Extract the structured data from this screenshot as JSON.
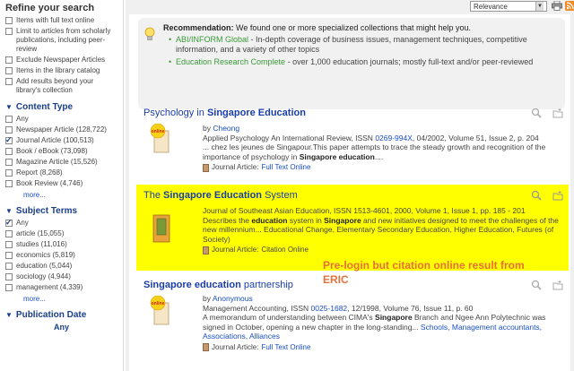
{
  "sidebar": {
    "title": "Refine your search",
    "refine_options": [
      {
        "label": "Items with full text online",
        "checked": false
      },
      {
        "label": "Limit to articles from scholarly publications, including peer-review",
        "checked": false
      },
      {
        "label": "Exclude Newspaper Articles",
        "checked": false
      },
      {
        "label": "Items in the library catalog",
        "checked": false
      },
      {
        "label": "Add results beyond your library's collection",
        "checked": false
      }
    ],
    "content_type": {
      "title": "Content Type",
      "items": [
        {
          "label": "Any",
          "checked": false
        },
        {
          "label": "Newspaper Article (128,722)",
          "checked": false
        },
        {
          "label": "Journal Article (100,513)",
          "checked": true
        },
        {
          "label": "Book / eBook (73,098)",
          "checked": false
        },
        {
          "label": "Magazine Article (15,526)",
          "checked": false
        },
        {
          "label": "Report (8,268)",
          "checked": false
        },
        {
          "label": "Book Review (4,746)",
          "checked": false
        }
      ],
      "more": "more..."
    },
    "subject_terms": {
      "title": "Subject Terms",
      "items": [
        {
          "label": "Any",
          "checked": true
        },
        {
          "label": "article (15,055)",
          "checked": false
        },
        {
          "label": "studies (11,016)",
          "checked": false
        },
        {
          "label": "economics (5,819)",
          "checked": false
        },
        {
          "label": "education (5,044)",
          "checked": false
        },
        {
          "label": "sociology (4,944)",
          "checked": false
        },
        {
          "label": "management (4,339)",
          "checked": false
        }
      ],
      "more": "more..."
    },
    "publication_date": {
      "title": "Publication Date",
      "value": "Any"
    }
  },
  "toolbar": {
    "sort_value": "Relevance",
    "print_icon": "print-icon",
    "rss_icon": "rss-icon"
  },
  "recommendation": {
    "label": "Recommendation:",
    "text": " We found one or more specialized collections that might help you.",
    "items": [
      {
        "link": "ABI/INFORM Global",
        "desc": " - In-depth coverage of business issues, management techniques, competitive information, and a variety of other topics"
      },
      {
        "link": "Education Research Complete",
        "desc": " - over 1,000 education journals; mostly full-text and/or peer-reviewed"
      }
    ]
  },
  "results": [
    {
      "title_pre": "Psychology in ",
      "title_bold": "Singapore Education",
      "title_post": "",
      "by": "by ",
      "author": "Cheong",
      "source_pre": "Applied Psychology An International Review, ISSN ",
      "issn": "0269-994X",
      "source_post": ", 04/2002, Volume 51, Issue 2, p. 204",
      "snippet_pre": "... chez les jeunes de Singapour.This paper attempts to trace the steady growth and recognition of the importance of psychology in ",
      "snippet_bold": "Singapore education",
      "snippet_post": "....",
      "type": "Journal Article:",
      "access": "Full Text Online",
      "badge": "online"
    },
    {
      "title_pre": "The ",
      "title_bold": "Singapore Education",
      "title_post": " System",
      "source": "Journal of Southeast Asian Education, ISSN 1513-4601, 2000, Volume 1, Issue 1, pp. 185 - 201",
      "snippet_a": "Describes the ",
      "snippet_b": "education",
      "snippet_c": " system in ",
      "snippet_d": "Singapore",
      "snippet_e": " and new initiatives designed to meet the challenges of the new millennium... Educational Change, Elementary Secondary Education, Higher Education, Futures (of Society)",
      "type": "Journal Article:",
      "access": "Citation Online"
    },
    {
      "title_bold": "Singapore education",
      "title_post": " partnership",
      "by": "by ",
      "author": "Anonymous",
      "source_pre": "Management Accounting, ISSN ",
      "issn": "0025-1682",
      "source_post": ", 12/1998, Volume 76, Issue 11, p. 60",
      "snippet_pre": "A memorandum of understanding between CIMA's ",
      "snippet_bold": "Singapore",
      "snippet_mid": " Branch and Ngee Ann Polytechnic was signed in October, opening a new chapter in the long-standing...",
      "tags": "Schools, Management accountants, Associations, Alliances",
      "type": "Journal Article:",
      "access": "Full Text Online",
      "badge": "online"
    }
  ],
  "annotation": "Pre-login but citation online result from ERIC",
  "colors": {
    "highlight": "#ffff00",
    "link": "#1a3ea8",
    "green_link": "#3a9a3a",
    "annotation": "#e8703a"
  }
}
